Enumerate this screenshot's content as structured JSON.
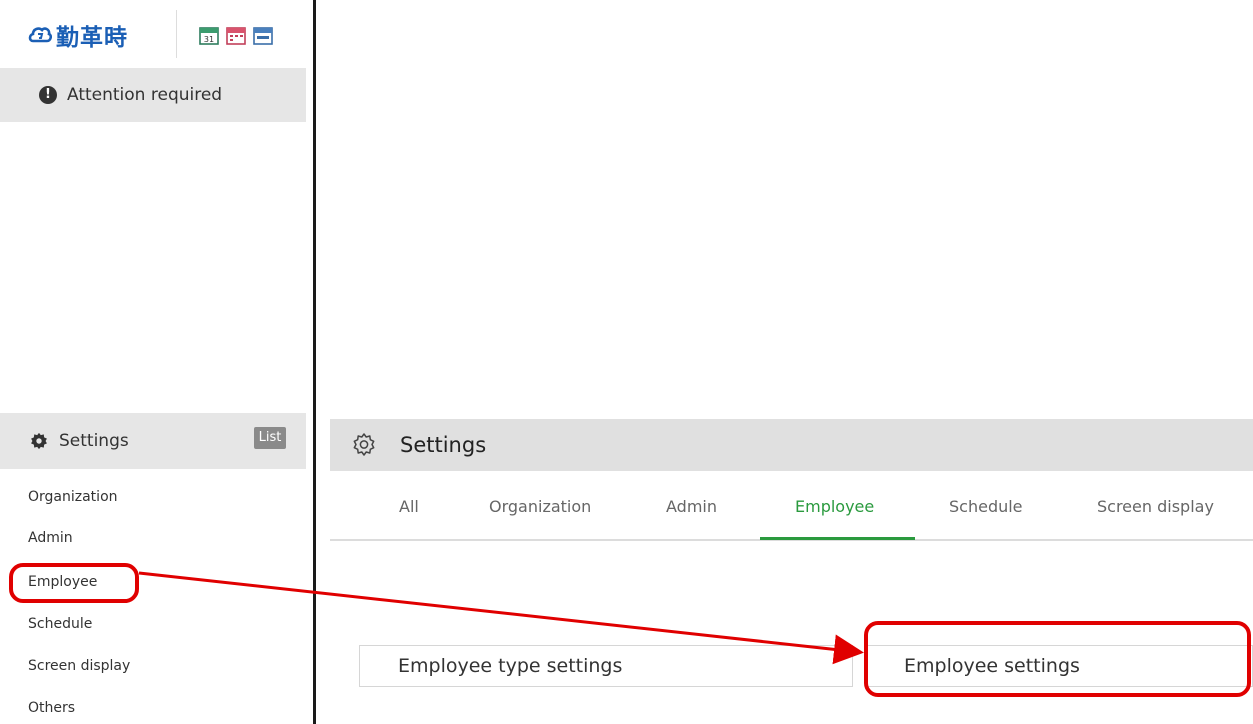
{
  "brand": {
    "logo_text": "勤革時"
  },
  "colors": {
    "accent_green": "#2a9a3e",
    "logo_blue": "#1b5fb5",
    "callout_red": "#e00000"
  },
  "sidebar": {
    "attention": {
      "icon": "exclamation-icon",
      "label": "Attention required"
    },
    "settings": {
      "icon": "gear-icon",
      "label": "Settings",
      "list_badge": "List"
    },
    "items": [
      {
        "label": "Organization"
      },
      {
        "label": "Admin"
      },
      {
        "label": "Employee"
      },
      {
        "label": "Schedule"
      },
      {
        "label": "Screen display"
      },
      {
        "label": "Others"
      }
    ]
  },
  "panel": {
    "title": "Settings",
    "tabs": [
      {
        "label": "All"
      },
      {
        "label": "Organization"
      },
      {
        "label": "Admin"
      },
      {
        "label": "Employee",
        "active": true
      },
      {
        "label": "Schedule"
      },
      {
        "label": "Screen display"
      }
    ],
    "buttons": [
      {
        "label": "Employee type settings"
      },
      {
        "label": "Employee settings"
      }
    ]
  }
}
